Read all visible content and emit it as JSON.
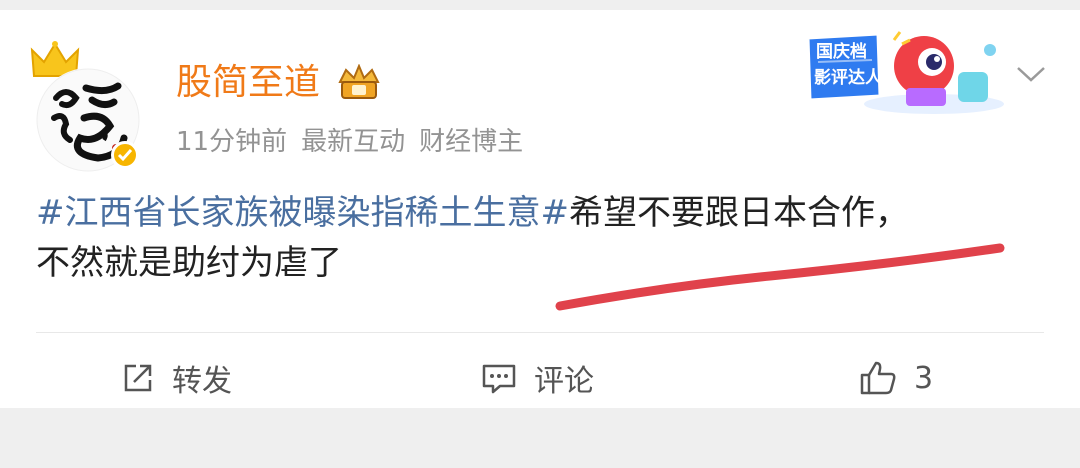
{
  "post": {
    "username": "股简至道",
    "meta": [
      "11分钟前",
      "最新互动",
      "财经博主"
    ],
    "hashtag": "#江西省长家族被曝染指稀土生意#",
    "body_line1": "希望不要跟日本合作，",
    "body_line2": "不然就是助纣为虐了"
  },
  "badge": {
    "line1": "国庆档",
    "line2": "影评达人"
  },
  "actions": {
    "repost_label": "转发",
    "comment_label": "评论",
    "like_count": "3"
  },
  "colors": {
    "username": "#f07a18",
    "hashtag": "#4a6fa0",
    "highlight": "#e0424b"
  }
}
